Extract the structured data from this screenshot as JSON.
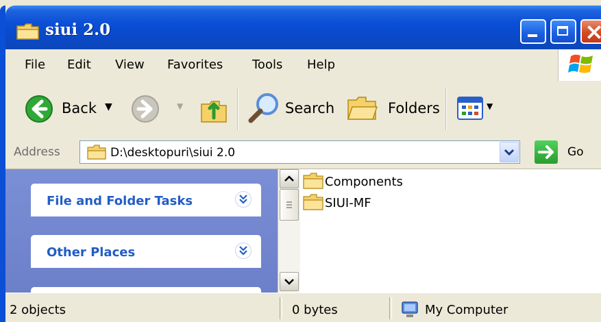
{
  "window": {
    "title": "siui 2.0",
    "controls": [
      "minimize",
      "maximize",
      "close"
    ]
  },
  "menu": {
    "items": [
      "File",
      "Edit",
      "View",
      "Favorites",
      "Tools",
      "Help"
    ]
  },
  "toolbar": {
    "back_label": "Back",
    "search_label": "Search",
    "folders_label": "Folders"
  },
  "address": {
    "label": "Address",
    "value": "D:\\desktopuri\\siui 2.0",
    "go_label": "Go"
  },
  "task_pane": {
    "sections": [
      {
        "title": "File and Folder Tasks"
      },
      {
        "title": "Other Places"
      }
    ]
  },
  "files": [
    {
      "name": "Components",
      "type": "folder"
    },
    {
      "name": "SIUI-MF",
      "type": "folder"
    }
  ],
  "status": {
    "objects": "2 objects",
    "size": "0 bytes",
    "location": "My Computer"
  },
  "colors": {
    "titlebar": "#0a4fd6",
    "taskpane": "#7b8fd6",
    "task_title": "#215dc6"
  }
}
